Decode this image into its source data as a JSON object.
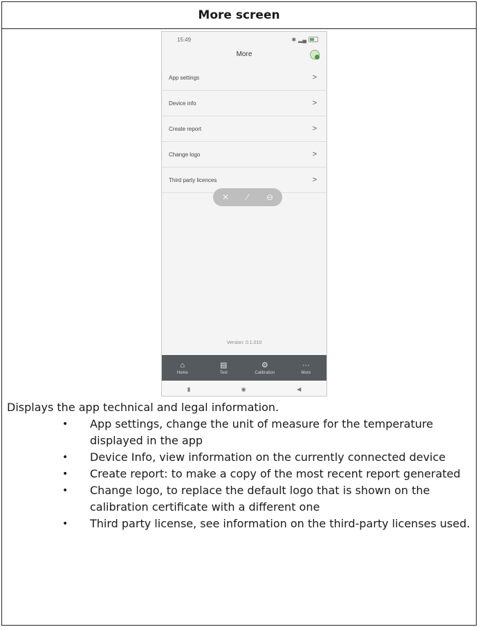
{
  "header": {
    "title": "More screen"
  },
  "phone": {
    "status_time": "15:49",
    "title": "More",
    "menu": [
      {
        "label": "App settings"
      },
      {
        "label": "Device info"
      },
      {
        "label": "Create report"
      },
      {
        "label": "Change logo"
      },
      {
        "label": "Third party licences"
      }
    ],
    "chevron": ">",
    "version": "Version: 0.1.010",
    "nav": [
      {
        "label": "Home",
        "icon": "home-icon"
      },
      {
        "label": "Test",
        "icon": "test-icon"
      },
      {
        "label": "Calibration",
        "icon": "gear-icon"
      },
      {
        "label": "More",
        "icon": "more-icon"
      }
    ]
  },
  "description": {
    "intro": "Displays the app technical and legal information.",
    "items": [
      {
        "text": "App settings, change the unit of measure for the temperature displayed in the app"
      },
      {
        "text": "Device Info, view information on the currently connected device"
      },
      {
        "text": "Create report: to make a copy of the most recent report generated"
      },
      {
        "text": "Change logo, to replace the default logo that is shown on the calibration certificate with a different one"
      },
      {
        "text": "Third party license, see information on the third-party licenses used."
      }
    ]
  }
}
